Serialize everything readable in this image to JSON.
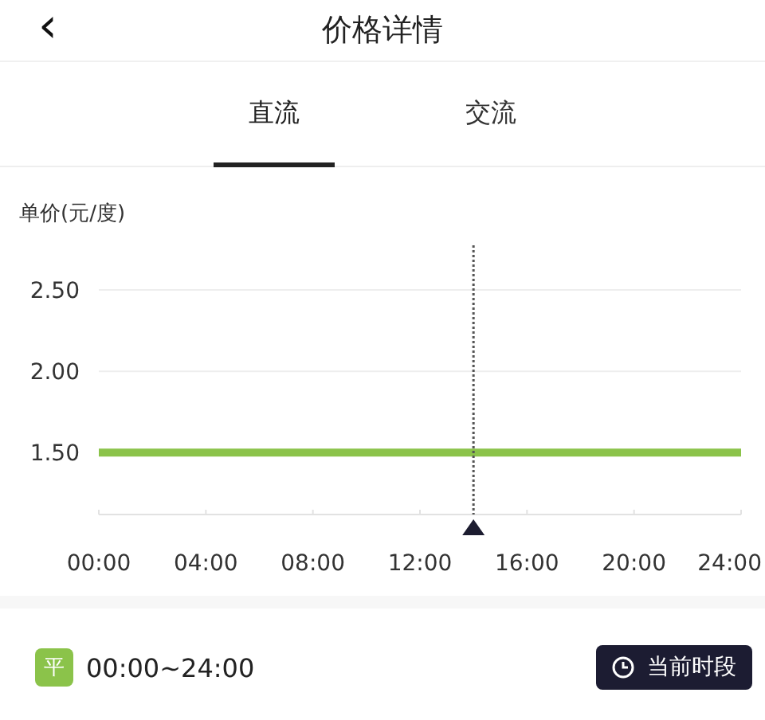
{
  "header": {
    "back_icon": "‹",
    "title": "价格详情"
  },
  "tabs": [
    {
      "label": "直流",
      "selected": true
    },
    {
      "label": "交流",
      "selected": false
    }
  ],
  "chart": {
    "chart_data": {
      "type": "line",
      "ylabel": "单价(元/度)",
      "x": [
        0,
        24
      ],
      "series": [
        {
          "color": "#8bc34a",
          "values": [
            1.5,
            1.5
          ]
        }
      ],
      "xlim": [
        0,
        24
      ],
      "ylim": [
        1.12,
        2.5
      ],
      "xticks": [
        {
          "value": 0,
          "label": "00:00"
        },
        {
          "value": 4,
          "label": "04:00"
        },
        {
          "value": 8,
          "label": "08:00"
        },
        {
          "value": 12,
          "label": "12:00"
        },
        {
          "value": 16,
          "label": "16:00"
        },
        {
          "value": 20,
          "label": "20:00"
        },
        {
          "value": 24,
          "label": "24:00"
        }
      ],
      "yticks": [
        {
          "value": 1.5,
          "label": "1.50"
        },
        {
          "value": 2,
          "label": "2.00"
        },
        {
          "value": 2.5,
          "label": "2.50"
        }
      ],
      "ref_lines": [
        {
          "axis": "x",
          "value": 14
        }
      ]
    }
  },
  "periods": [
    {
      "badge": "平",
      "color": "#8bc34a",
      "time_range": "00:00~24:00",
      "current": true,
      "current_label": "当前时段"
    }
  ]
}
